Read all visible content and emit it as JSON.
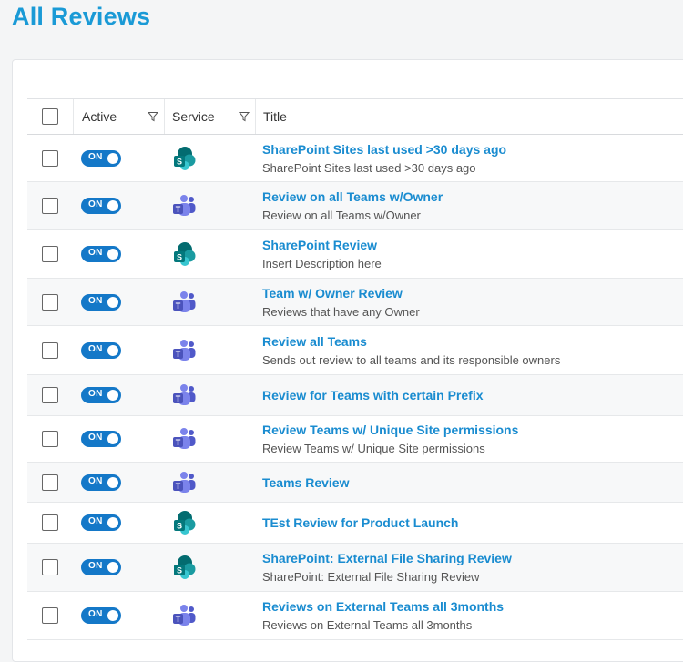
{
  "page": {
    "title": "All Reviews"
  },
  "table": {
    "headers": {
      "active": "Active",
      "service": "Service",
      "title": "Title"
    },
    "rows": [
      {
        "toggle": "ON",
        "service": "sharepoint",
        "title": "SharePoint Sites last used >30 days ago",
        "description": "SharePoint Sites last used >30 days ago"
      },
      {
        "toggle": "ON",
        "service": "teams",
        "title": "Review on all Teams w/Owner",
        "description": "Review on all Teams w/Owner"
      },
      {
        "toggle": "ON",
        "service": "sharepoint",
        "title": "SharePoint Review",
        "description": "Insert Description here"
      },
      {
        "toggle": "ON",
        "service": "teams",
        "title": "Team w/ Owner Review",
        "description": "Reviews that have any Owner"
      },
      {
        "toggle": "ON",
        "service": "teams",
        "title": "Review all Teams",
        "description": "Sends out review to all teams and its responsible owners"
      },
      {
        "toggle": "ON",
        "service": "teams",
        "title": "Review for Teams with certain Prefix",
        "description": ""
      },
      {
        "toggle": "ON",
        "service": "teams",
        "title": "Review Teams w/ Unique Site permissions",
        "description": "Review Teams w/ Unique Site permissions"
      },
      {
        "toggle": "ON",
        "service": "teams",
        "title": "Teams Review",
        "description": ""
      },
      {
        "toggle": "ON",
        "service": "sharepoint",
        "title": "TEst Review for Product Launch",
        "description": ""
      },
      {
        "toggle": "ON",
        "service": "sharepoint",
        "title": "SharePoint: External File Sharing Review",
        "description": "SharePoint: External File Sharing Review"
      },
      {
        "toggle": "ON",
        "service": "teams",
        "title": "Reviews on External Teams all 3months",
        "description": "Reviews on External Teams all 3months"
      }
    ]
  },
  "colors": {
    "accent": "#1a9ad6",
    "toggle": "#1478c8",
    "teams": "#5b5fc7",
    "sharepoint": "#038387"
  }
}
